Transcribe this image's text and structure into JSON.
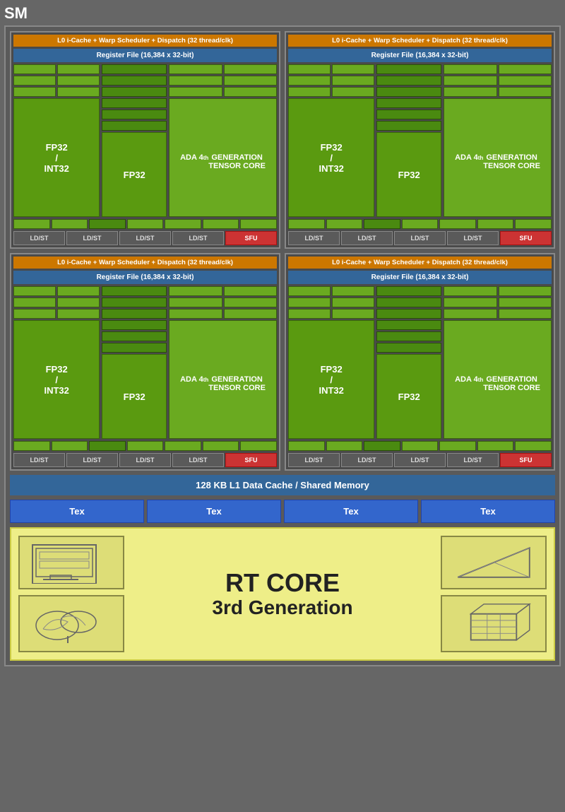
{
  "sm_label": "SM",
  "quadrants": [
    {
      "id": "q1",
      "l0_header": "L0 i-Cache + Warp Scheduler + Dispatch (32 thread/clk)",
      "register_file": "Register File (16,384 x 32-bit)",
      "fp32_int32_label": "FP32\n/\nINT32",
      "fp32_label": "FP32",
      "tensor_label": "ADA 4th GENERATION TENSOR CORE",
      "ldst_labels": [
        "LD/ST",
        "LD/ST",
        "LD/ST",
        "LD/ST"
      ],
      "sfu_label": "SFU"
    },
    {
      "id": "q2",
      "l0_header": "L0 i-Cache + Warp Scheduler + Dispatch (32 thread/clk)",
      "register_file": "Register File (16,384 x 32-bit)",
      "fp32_int32_label": "FP32\n/\nINT32",
      "fp32_label": "FP32",
      "tensor_label": "ADA 4th GENERATION TENSOR CORE",
      "ldst_labels": [
        "LD/ST",
        "LD/ST",
        "LD/ST",
        "LD/ST"
      ],
      "sfu_label": "SFU"
    },
    {
      "id": "q3",
      "l0_header": "L0 i-Cache + Warp Scheduler + Dispatch (32 thread/clk)",
      "register_file": "Register File (16,384 x 32-bit)",
      "fp32_int32_label": "FP32\n/\nINT32",
      "fp32_label": "FP32",
      "tensor_label": "ADA 4th GENERATION TENSOR CORE",
      "ldst_labels": [
        "LD/ST",
        "LD/ST",
        "LD/ST",
        "LD/ST"
      ],
      "sfu_label": "SFU"
    },
    {
      "id": "q4",
      "l0_header": "L0 i-Cache + Warp Scheduler + Dispatch (32 thread/clk)",
      "register_file": "Register File (16,384 x 32-bit)",
      "fp32_int32_label": "FP32\n/\nINT32",
      "fp32_label": "FP32",
      "tensor_label": "ADA 4th GENERATION TENSOR CORE",
      "ldst_labels": [
        "LD/ST",
        "LD/ST",
        "LD/ST",
        "LD/ST"
      ],
      "sfu_label": "SFU"
    }
  ],
  "l1_cache_label": "128 KB L1 Data Cache / Shared Memory",
  "tex_labels": [
    "Tex",
    "Tex",
    "Tex",
    "Tex"
  ],
  "rt_core_title": "RT CORE",
  "rt_core_subtitle": "3rd Generation",
  "colors": {
    "orange": "#cc7700",
    "blue_header": "#336699",
    "green_cell": "#6aaa20",
    "green_dark": "#4a8a10",
    "red_sfu": "#cc3333",
    "tex_blue": "#3366cc",
    "rt_yellow": "#eeee88"
  }
}
